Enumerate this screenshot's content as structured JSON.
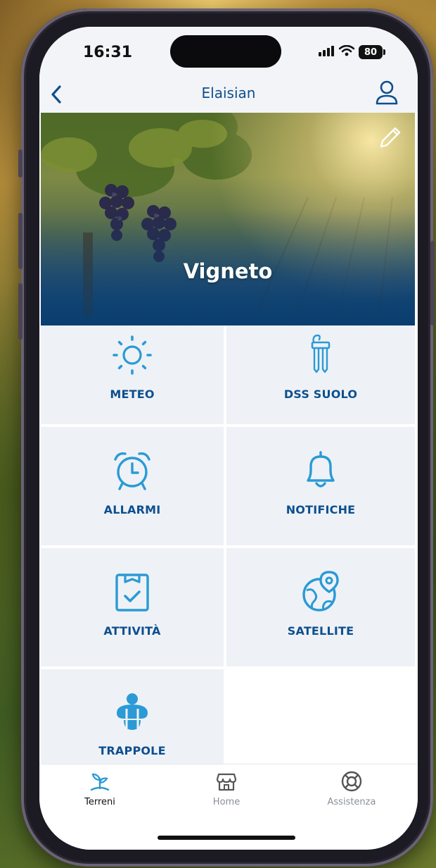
{
  "status_bar": {
    "time": "16:31",
    "battery": "80"
  },
  "nav": {
    "title": "Elaisian"
  },
  "hero": {
    "title": "Vigneto"
  },
  "tiles": [
    {
      "label": "METEO",
      "icon": "sun-icon"
    },
    {
      "label": "DSS SUOLO",
      "icon": "soil-sensor-icon"
    },
    {
      "label": "ALLARMI",
      "icon": "alarm-clock-icon"
    },
    {
      "label": "NOTIFICHE",
      "icon": "bell-icon"
    },
    {
      "label": "ATTIVITÀ",
      "icon": "clipboard-check-icon"
    },
    {
      "label": "SATELLITE",
      "icon": "globe-pin-icon"
    },
    {
      "label": "TRAPPOLE",
      "icon": "insect-trap-icon"
    }
  ],
  "tabbar": {
    "items": [
      {
        "label": "Terreni",
        "icon": "sprout-icon",
        "active": true
      },
      {
        "label": "Home",
        "icon": "store-icon",
        "active": false
      },
      {
        "label": "Assistenza",
        "icon": "lifebuoy-icon",
        "active": false
      }
    ]
  },
  "colors": {
    "accent": "#2b9ad6",
    "title_blue": "#0e4f8f",
    "tile_bg": "#eef2f6",
    "inactive_tab": "#8a8f98"
  }
}
